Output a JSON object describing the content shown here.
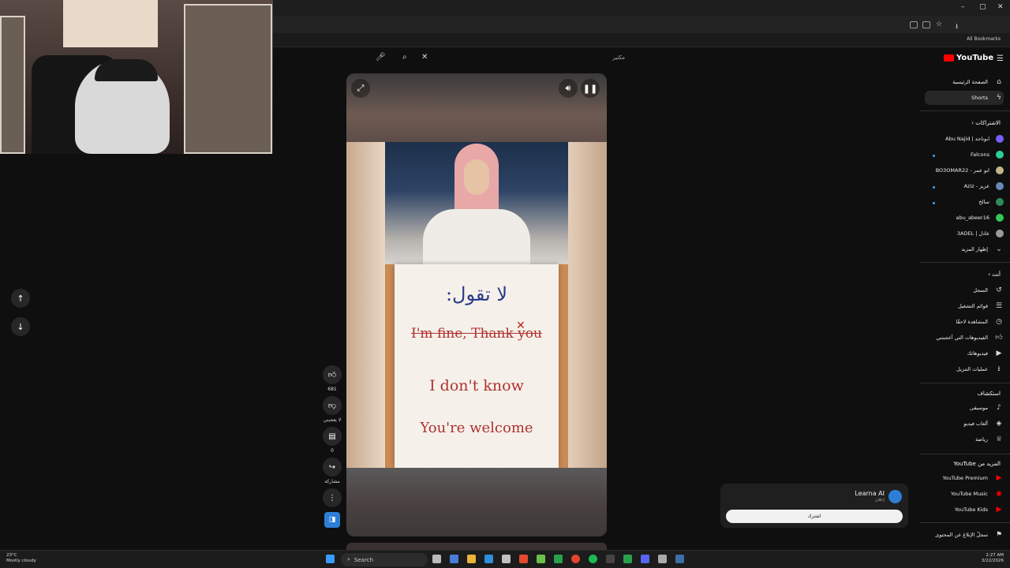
{
  "browser": {
    "bookmarks_label": "All Bookmarks"
  },
  "search": {
    "query": "",
    "right_hint": "مكثير"
  },
  "video": {
    "paper_title": "لا تقول:",
    "line1": "I'm fine, Thank you",
    "line2": "I don't know",
    "line3": "You're welcome"
  },
  "actions": {
    "like_count": "681",
    "dislike_label": "لا يعجبني",
    "comments_count": "0",
    "share_label": "مشاركة"
  },
  "sidebar": {
    "logo": "YouTube",
    "home": "الصفحة الرئيسية",
    "shorts": "Shorts",
    "subscriptions_header": "الاشتراكات",
    "subs": [
      {
        "name": "ابوناجد | Abu Najid",
        "color": "#7a5cff"
      },
      {
        "name": "Falcons",
        "color": "#2ecc9a"
      },
      {
        "name": "ابو عمر - BO3OMAR22",
        "color": "#c4b48a"
      },
      {
        "name": "عزيز - Aziz",
        "color": "#6a88b8"
      },
      {
        "name": "سالخ",
        "color": "#2e8b57"
      },
      {
        "name": "abu_abeer16",
        "color": "#34c759"
      },
      {
        "name": "عادل | 3ADEL",
        "color": "#9a9a9a"
      }
    ],
    "show_more": "إظهار المزيد",
    "you_header": "أنت",
    "you_items": [
      {
        "label": "السجل",
        "icon": "history-icon"
      },
      {
        "label": "قوائم التشغيل",
        "icon": "playlists-icon"
      },
      {
        "label": "المشاهدة لاحقًا",
        "icon": "watch-later-icon"
      },
      {
        "label": "الفيديوهات التي أعجبتني",
        "icon": "liked-icon"
      },
      {
        "label": "فيديوهاتك",
        "icon": "your-videos-icon"
      },
      {
        "label": "عمليات التنزيل",
        "icon": "downloads-icon"
      }
    ],
    "explore_header": "استكشاف",
    "explore_items": [
      {
        "label": "موسيقى",
        "icon": "music-icon"
      },
      {
        "label": "ألعاب فيديو",
        "icon": "gaming-icon"
      },
      {
        "label": "رياضة",
        "icon": "sports-icon"
      }
    ],
    "more_header": "المزيد من YouTube",
    "more_items": [
      {
        "label": "YouTube Premium"
      },
      {
        "label": "YouTube Music"
      },
      {
        "label": "YouTube Kids"
      }
    ],
    "report": "سجلّ الإبلاغ عن المحتوى"
  },
  "notification": {
    "channel": "Learna AI",
    "sub": "إعلان",
    "button": "اشترك"
  },
  "taskbar": {
    "temp": "23°C",
    "weather": "Mostly cloudy",
    "search": "Search",
    "time": "2:27 AM",
    "date": "3/22/2026"
  }
}
